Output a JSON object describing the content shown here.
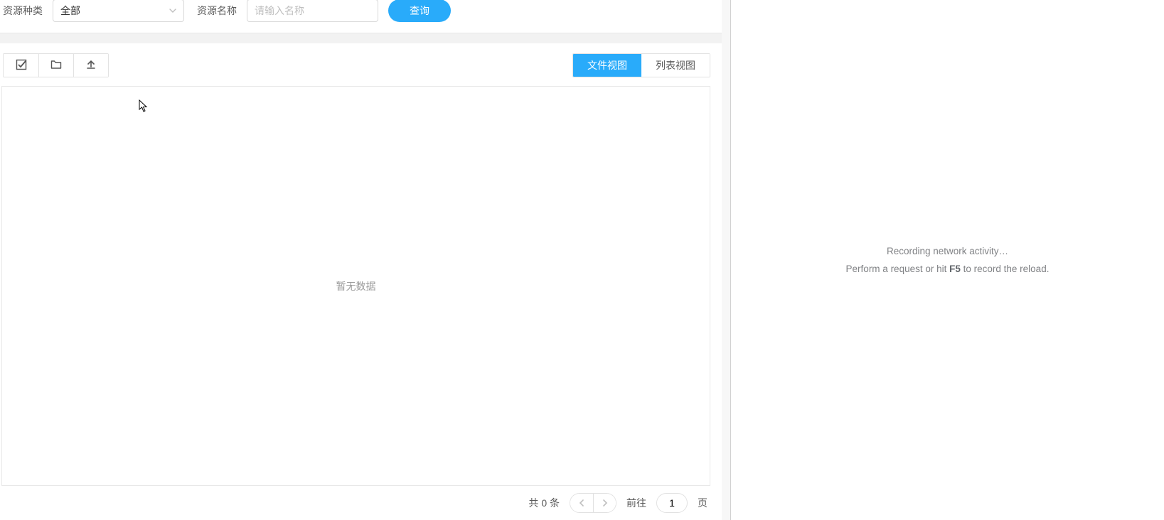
{
  "search": {
    "type_label": "资源种类",
    "type_value": "全部",
    "name_label": "资源名称",
    "name_placeholder": "请输入名称",
    "query_button": "查询"
  },
  "toolbar": {
    "icons": {
      "select_all": "选择全部",
      "folder": "文件夹",
      "upload": "上传"
    }
  },
  "view_toggle": {
    "file": "文件视图",
    "list": "列表视图",
    "active": "file"
  },
  "content": {
    "empty_text": "暂无数据"
  },
  "pager": {
    "total_prefix": "共",
    "total_count": "0",
    "total_suffix": "条",
    "goto_label": "前往",
    "goto_value": "1",
    "page_suffix": "页"
  },
  "devtools": {
    "line1": "Recording network activity…",
    "line2_before": "Perform a request or hit ",
    "line2_key": "F5",
    "line2_after": " to record the reload."
  },
  "colors": {
    "primary": "#29abfa",
    "border": "#e2e2e2",
    "text_muted": "#999"
  }
}
